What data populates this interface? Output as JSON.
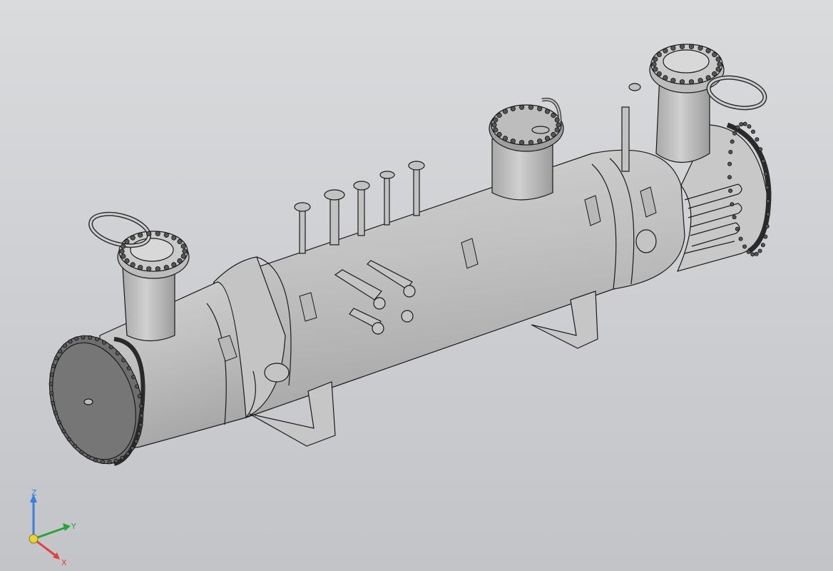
{
  "viewport": {
    "background_top": "#dadbdd",
    "background_bottom": "#c3c4c8",
    "model_fill": "#bdbdbd",
    "model_shade": "#a9a9a9",
    "model_light": "#cfcfcf",
    "edge_color": "#1a1a1a"
  },
  "axis_triad": {
    "z_label": "Z",
    "y_label": "Y",
    "x_label": "X",
    "z_color": "#3a7ee0",
    "y_color": "#2aa43a",
    "x_color": "#e04040",
    "origin_color": "#e8d33a"
  }
}
